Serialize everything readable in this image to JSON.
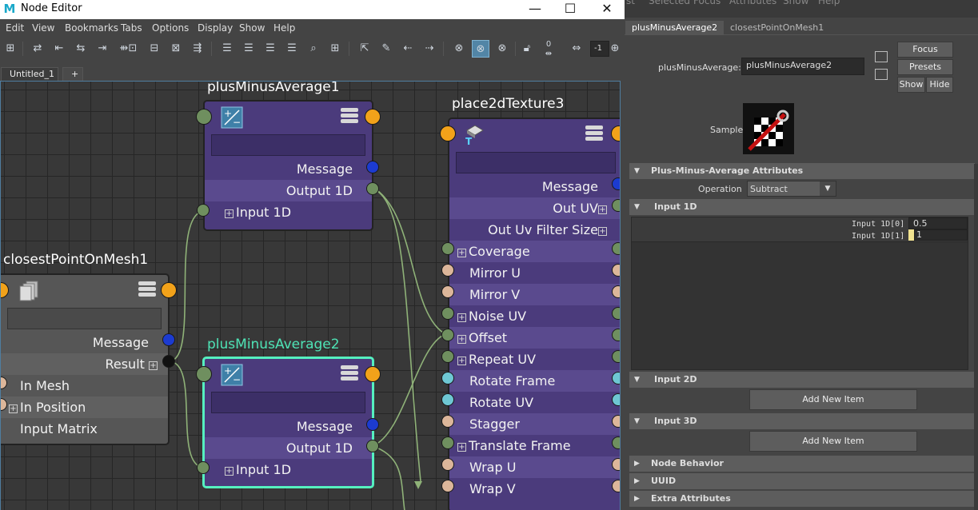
{
  "window": {
    "title": "Node Editor",
    "minimize": "—",
    "maximize": "☐",
    "close": "✕",
    "logo": "M"
  },
  "menu": [
    "Edit",
    "View",
    "Bookmarks",
    "Tabs",
    "Options",
    "Display",
    "Show",
    "Help"
  ],
  "toolbar": {
    "field_value": "-1",
    "zero_label": "0"
  },
  "tabs": {
    "active": "Untitled_1",
    "add": "+"
  },
  "nodes": {
    "pma1": {
      "title": "plusMinusAverage1",
      "rows": [
        "Message",
        "Output 1D",
        "Input 1D"
      ]
    },
    "pma2": {
      "title": "plusMinusAverage2",
      "rows": [
        "Message",
        "Output 1D",
        "Input 1D"
      ]
    },
    "cpom": {
      "title": "closestPointOnMesh1",
      "rows": [
        "Message",
        "Result",
        "In Mesh",
        "In Position",
        "Input Matrix"
      ]
    },
    "p2d": {
      "title": "place2dTexture3",
      "rows": [
        "Message",
        "Out UV",
        "Out Uv Filter Size",
        "Coverage",
        "Mirror U",
        "Mirror V",
        "Noise UV",
        "Offset",
        "Repeat UV",
        "Rotate Frame",
        "Rotate UV",
        "Stagger",
        "Translate Frame",
        "Wrap U",
        "Wrap V"
      ]
    }
  },
  "ae": {
    "top_menu": [
      "st",
      "Selected",
      "Focus",
      "Attributes",
      "Show",
      "Help"
    ],
    "tabs": [
      "plusMinusAverage2",
      "closestPointOnMesh1"
    ],
    "node_label": "plusMinusAverage:",
    "node_value": "plusMinusAverage2",
    "focus": "Focus",
    "presets": "Presets",
    "show": "Show",
    "hide": "Hide",
    "sample": "Sample",
    "sections": {
      "pma_attrs": "Plus-Minus-Average Attributes",
      "input1d": "Input 1D",
      "input2d": "Input 2D",
      "input3d": "Input 3D",
      "node_behavior": "Node Behavior",
      "uuid": "UUID",
      "extra": "Extra Attributes"
    },
    "operation_label": "Operation",
    "operation_value": "Subtract",
    "input1d_items": [
      {
        "label": "Input 1D[0]",
        "value": "0.5"
      },
      {
        "label": "Input 1D[1]",
        "value": "1"
      }
    ],
    "add_new_item": "Add New Item"
  }
}
